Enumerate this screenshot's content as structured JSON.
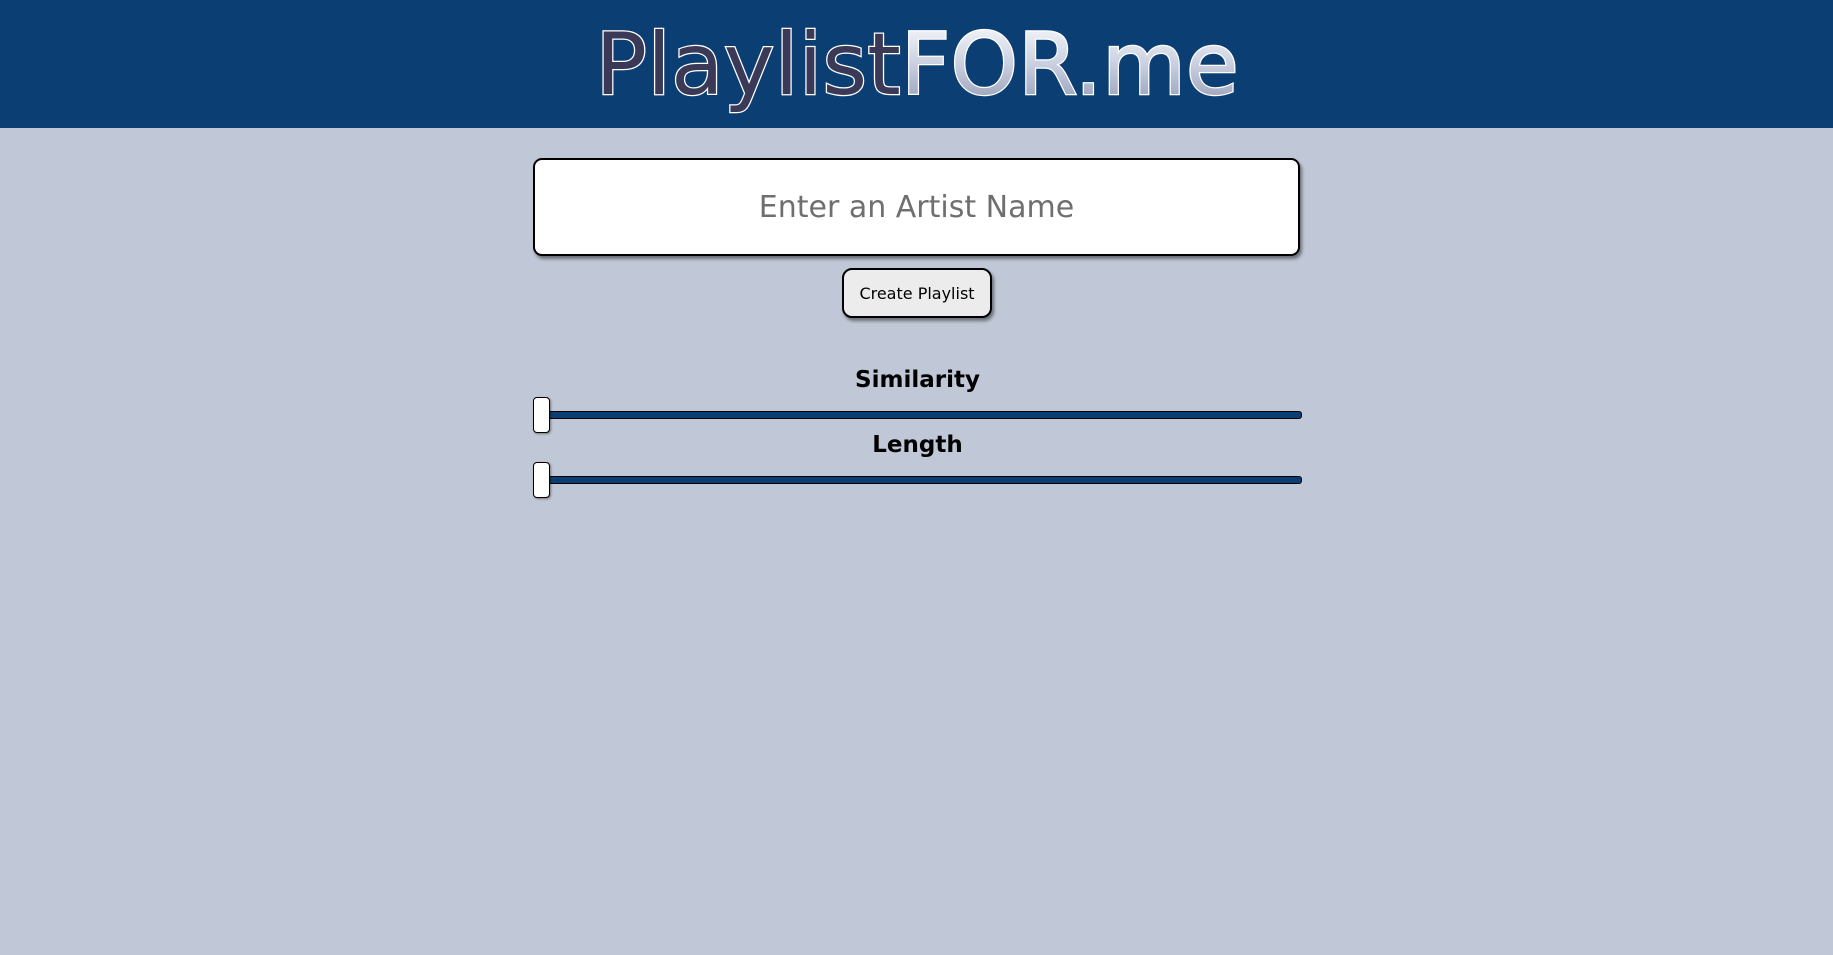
{
  "header": {
    "logo_part1": "Playlist",
    "logo_part2": "FOR.me",
    "background_color": "#0b3f73"
  },
  "search": {
    "placeholder": "Enter an Artist Name",
    "value": ""
  },
  "create_button": {
    "label": "Create Playlist"
  },
  "sliders": {
    "similarity": {
      "label": "Similarity",
      "value": 0
    },
    "length": {
      "label": "Length",
      "value": 0
    }
  },
  "colors": {
    "page_background": "#c0c7d6",
    "accent": "#0b3f73"
  }
}
